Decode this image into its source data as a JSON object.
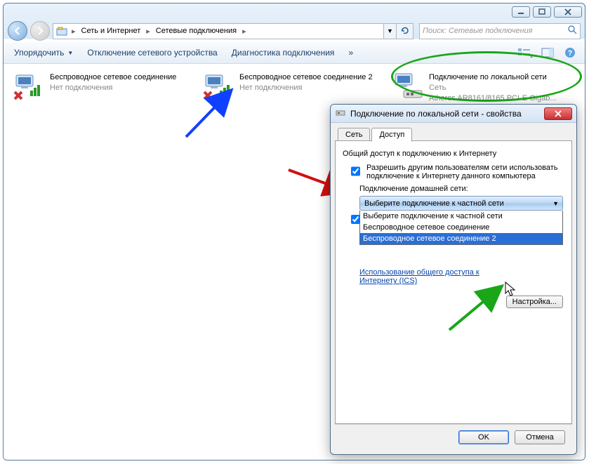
{
  "breadcrumb": {
    "seg1": "Сеть и Интернет",
    "seg2": "Сетевые подключения"
  },
  "search": {
    "placeholder": "Поиск: Сетевые подключения"
  },
  "toolbar": {
    "organize": "Упорядочить",
    "disable": "Отключение сетевого устройства",
    "diagnose": "Диагностика подключения",
    "more": "»"
  },
  "connections": [
    {
      "name": "Беспроводное сетевое соединение",
      "status": "Нет подключения"
    },
    {
      "name": "Беспроводное сетевое соединение 2",
      "status": "Нет подключения"
    },
    {
      "name": "Подключение по локальной сети",
      "status": "Сеть",
      "device": "Atheros AR8161/8165 PCI-E Gigab..."
    }
  ],
  "dialog": {
    "title": "Подключение по локальной сети - свойства",
    "tabs": {
      "net": "Сеть",
      "access": "Доступ"
    },
    "group_title": "Общий доступ к подключению к Интернету",
    "chk_allow": "Разрешить другим пользователям сети использовать подключение к Интернету данного компьютера",
    "home_label": "Подключение домашней сети:",
    "combo_selected": "Выберите подключение к частной сети",
    "combo_options": [
      "Выберите подключение к частной сети",
      "Беспроводное сетевое соединение",
      "Беспроводное сетевое соединение 2"
    ],
    "chk_manage_prefix": "",
    "link": "Использование общего доступа к Интернету (ICS)",
    "settings_btn": "Настройка...",
    "ok": "OK",
    "cancel": "Отмена"
  }
}
